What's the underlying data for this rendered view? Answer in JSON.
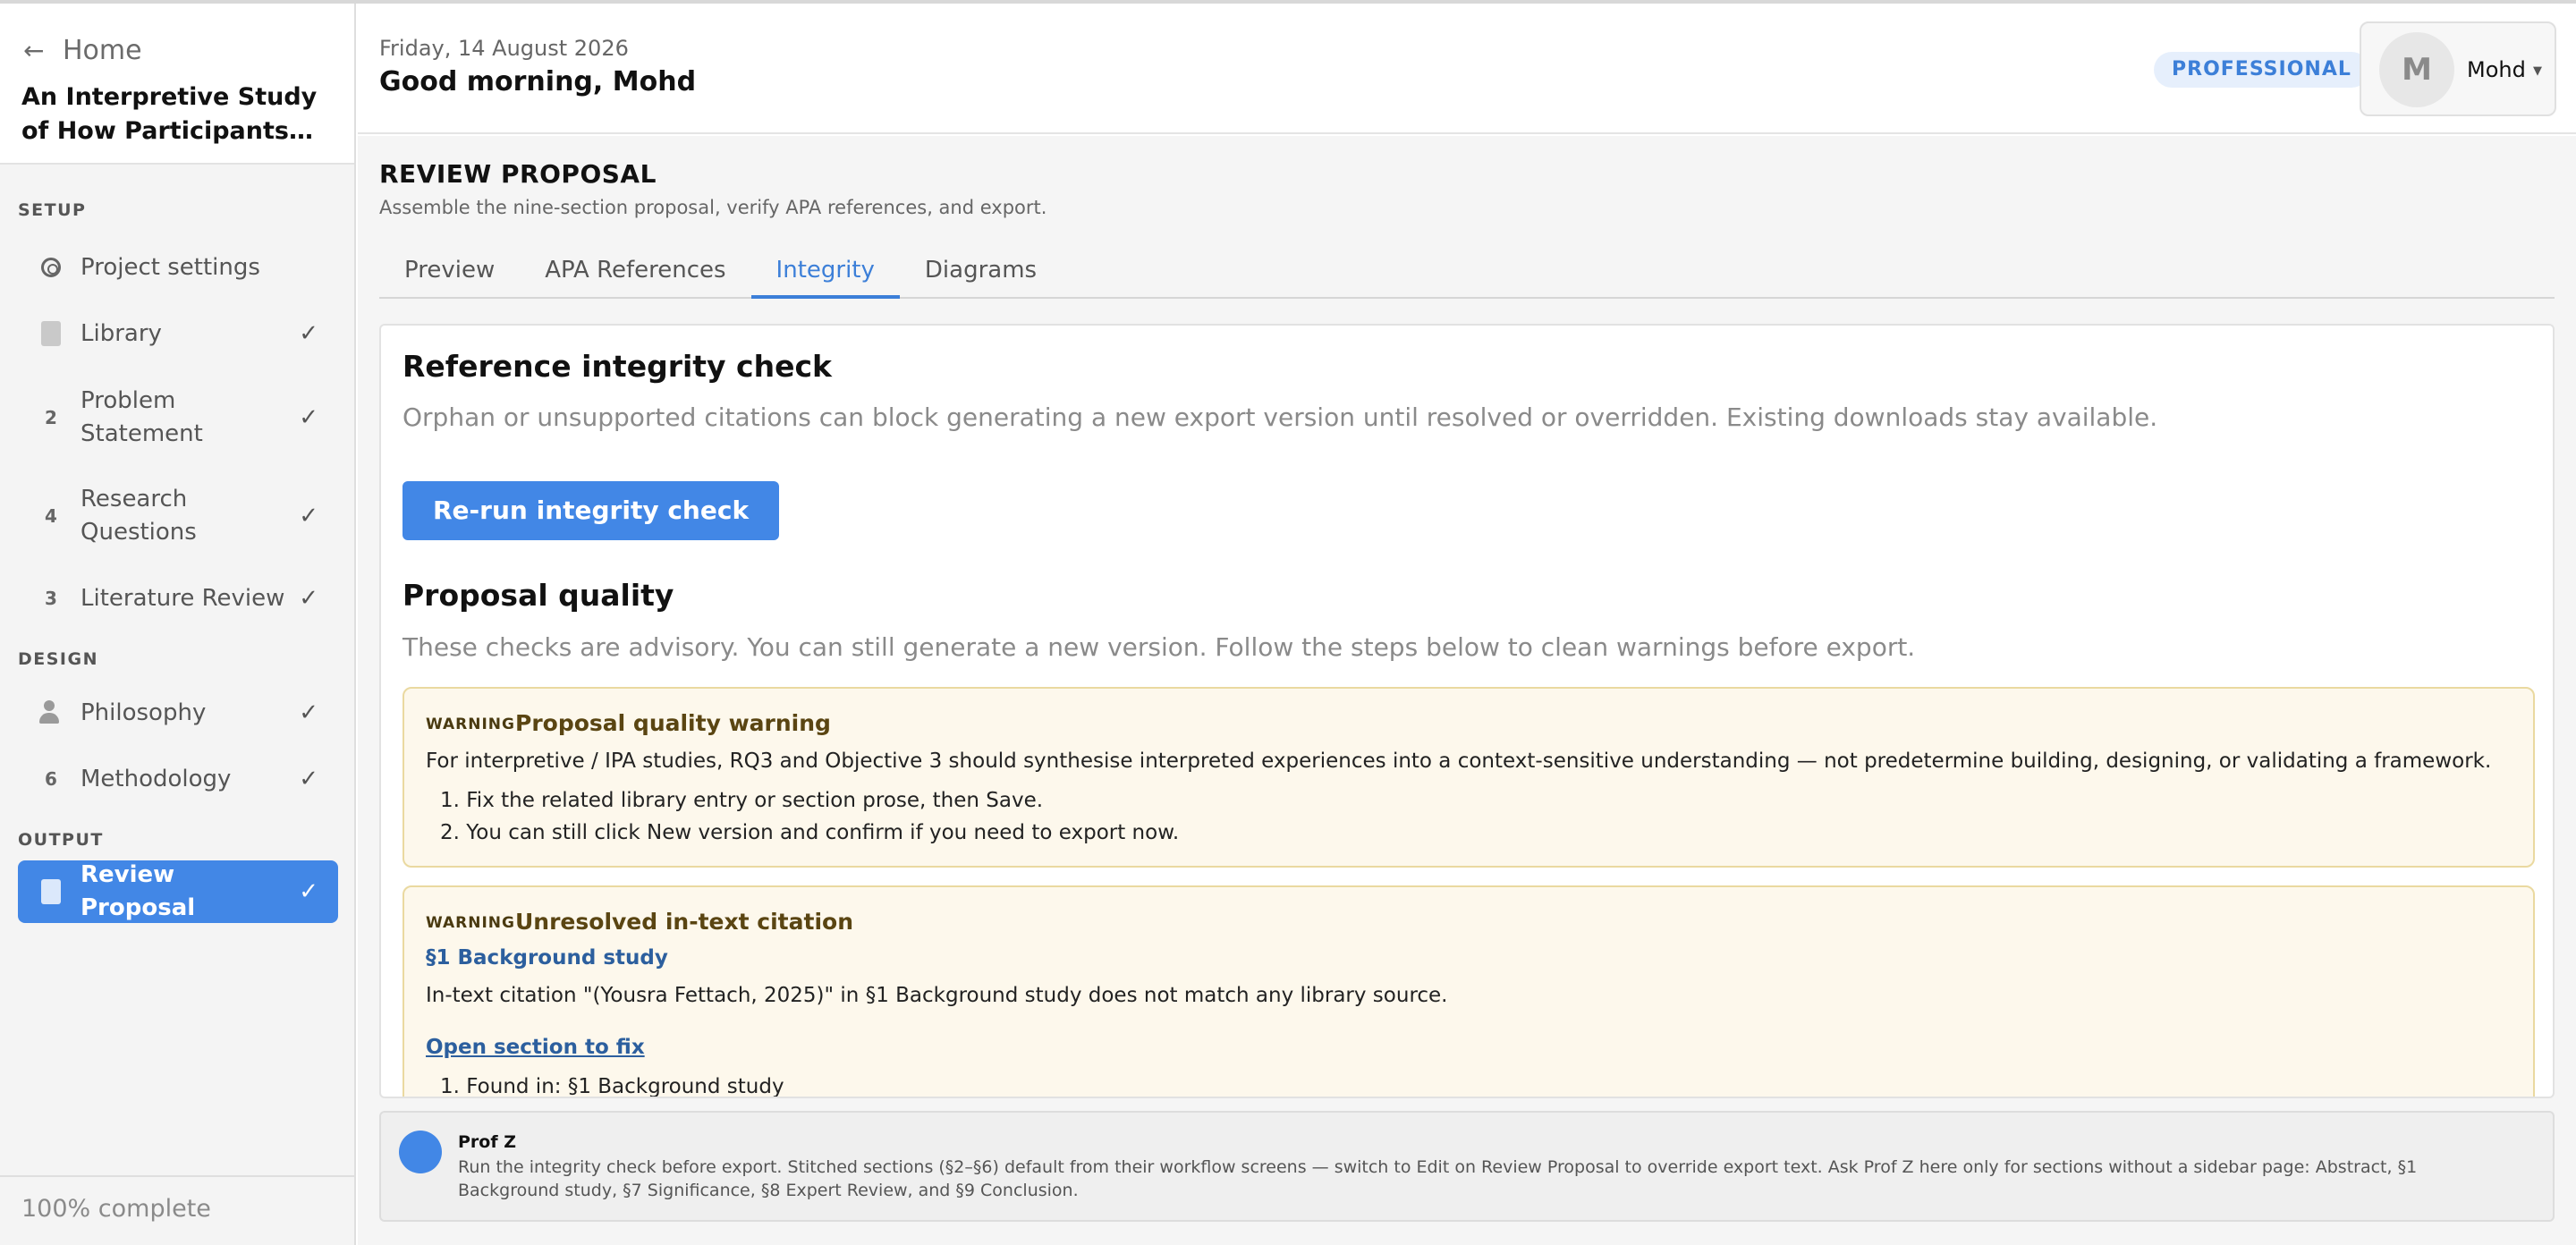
{
  "sidebar": {
    "home_label": "Home",
    "project_title": "An Interpretive Study of How Participants…",
    "sections": {
      "setup": "SETUP",
      "design": "DESIGN",
      "output": "OUTPUT"
    },
    "items": {
      "project_settings": "Project settings",
      "library": "Library",
      "problem_statement": "Problem Statement",
      "research_questions": "Research Questions",
      "literature_review": "Literature Review",
      "philosophy": "Philosophy",
      "methodology": "Methodology",
      "review_proposal": "Review Proposal"
    },
    "step_numbers": {
      "problem_statement": "2",
      "research_questions": "4",
      "literature_review": "3",
      "methodology": "6"
    },
    "progress": "100% complete"
  },
  "header": {
    "date": "Friday, 14 August 2026",
    "greeting": "Good morning, Mohd",
    "plan_badge": "PROFESSIONAL",
    "avatar_initial": "M",
    "user_name": "Mohd"
  },
  "page": {
    "title": "REVIEW PROPOSAL",
    "subtitle": "Assemble the nine-section proposal, verify APA references, and export.",
    "tabs": {
      "preview": "Preview",
      "apa": "APA References",
      "integrity": "Integrity",
      "diagrams": "Diagrams"
    }
  },
  "integrity": {
    "heading": "Reference integrity check",
    "description": "Orphan or unsupported citations can block generating a new export version until resolved or overridden. Existing downloads stay available.",
    "rerun_button": "Re-run integrity check"
  },
  "quality": {
    "heading": "Proposal quality",
    "description": "These checks are advisory. You can still generate a new version. Follow the steps below to clean warnings before export.",
    "warning1": {
      "tag": "WARNING",
      "title": "Proposal quality warning",
      "body": "For interpretive / IPA studies, RQ3 and Objective 3 should synthesise interpreted experiences into a context-sensitive understanding — not predetermine building, designing, or validating a framework.",
      "step1": "1. Fix the related library entry or section prose, then Save.",
      "step2": "2. You can still click New version and confirm if you need to export now."
    },
    "warning2": {
      "tag": "WARNING",
      "title": "Unresolved in-text citation",
      "section": "§1 Background study",
      "body": "In-text citation \"(Yousra Fettach, 2025)\" in §1 Background study does not match any library source.",
      "link": "Open section to fix",
      "step1": "1. Found in: §1 Background study"
    }
  },
  "assistant": {
    "name": "Prof Z",
    "message": "Run the integrity check before export. Stitched sections (§2–§6) default from their workflow screens — switch to Edit on Review Proposal to override export text. Ask Prof Z here only for sections without a sidebar page: Abstract, §1 Background study, §7 Significance, §8 Expert Review, and §9 Conclusion."
  },
  "colors": {
    "accent": "#4287e6",
    "warning_bg": "#fdf8ec",
    "warning_border": "#ead9a0"
  }
}
